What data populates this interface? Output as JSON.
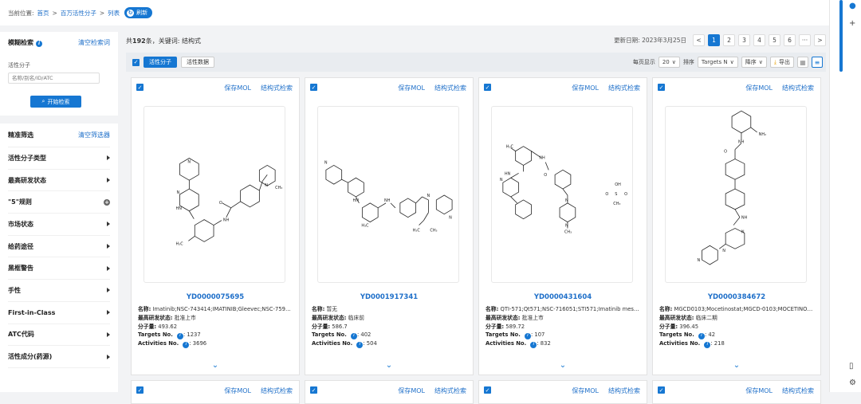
{
  "breadcrumb": {
    "prefix": "当前位置:",
    "items": [
      "首页",
      "百万活性分子",
      "列表"
    ],
    "sep": ">",
    "refresh": "刷新"
  },
  "left": {
    "search": {
      "title": "模糊检索",
      "clear": "清空检索词",
      "field_label": "活性分子",
      "placeholder": "名称/别名/ID/ATC",
      "button": "开始检索"
    },
    "filter": {
      "title": "精准筛选",
      "clear": "清空筛选器",
      "items": [
        "活性分子类型",
        "最高研发状态",
        "\"5\"规则",
        "市场状态",
        "给药途径",
        "黑框警告",
        "手性",
        "First-in-Class",
        "ATC代码",
        "活性成分(药源)"
      ]
    }
  },
  "summary": {
    "count_prefix": "共",
    "count": "192",
    "count_suffix": "条，关键词: 结构式"
  },
  "pager": {
    "updated": "更新日期: 2023年3月25日",
    "prev": "<",
    "pages": [
      "1",
      "2",
      "3",
      "4",
      "5",
      "6"
    ],
    "ellipsis": "···",
    "next": ">"
  },
  "toolbar": {
    "tab_active": "活性分子",
    "tab_other": "活性数据",
    "per_page_label": "每页显示",
    "per_page": "20",
    "sort_label": "排序",
    "sort_field": "Targets N",
    "order": "降序",
    "export": "导出"
  },
  "card_actions": {
    "save": "保存MOL",
    "search": "结构式检索"
  },
  "labels": {
    "name": "名称:",
    "status": "最高研发状态:",
    "mw": "分子量:",
    "targets": "Targets No.",
    "activities": "Activities No."
  },
  "cards": [
    {
      "id": "YD0000075695",
      "name": "Imatinib;NSC-743414;IMATINIB;Gleevec;NSC-759854;S...",
      "status": "批准上市",
      "mw": "493.62",
      "targets": "1237",
      "activities": "3696"
    },
    {
      "id": "YD0001917341",
      "name": "暂无",
      "status": "临床前",
      "mw": "586.7",
      "targets": "402",
      "activities": "504"
    },
    {
      "id": "YD0000431604",
      "name": "QTI-571;Qt571;NSC-716051;STI571;Imatinib mesylate;...",
      "status": "批准上市",
      "mw": "589.72",
      "targets": "107",
      "activities": "832"
    },
    {
      "id": "YD0000384672",
      "name": "MGCD0103;Mocetinostat;MGCD-0103;MOCETINOSTAT",
      "status": "临床二期",
      "mw": "396.45",
      "targets": "42",
      "activities": "218"
    }
  ],
  "mol_labels": {
    "h3c": "H₃C",
    "ch3": "CH₃",
    "nh": "NH",
    "n": "N",
    "o": "O",
    "nh2": "NH₂",
    "hn": "HN",
    "oh": "OH",
    "s": "S"
  },
  "colors": {
    "accent": "#1677d2",
    "link": "#1e6fc9"
  }
}
